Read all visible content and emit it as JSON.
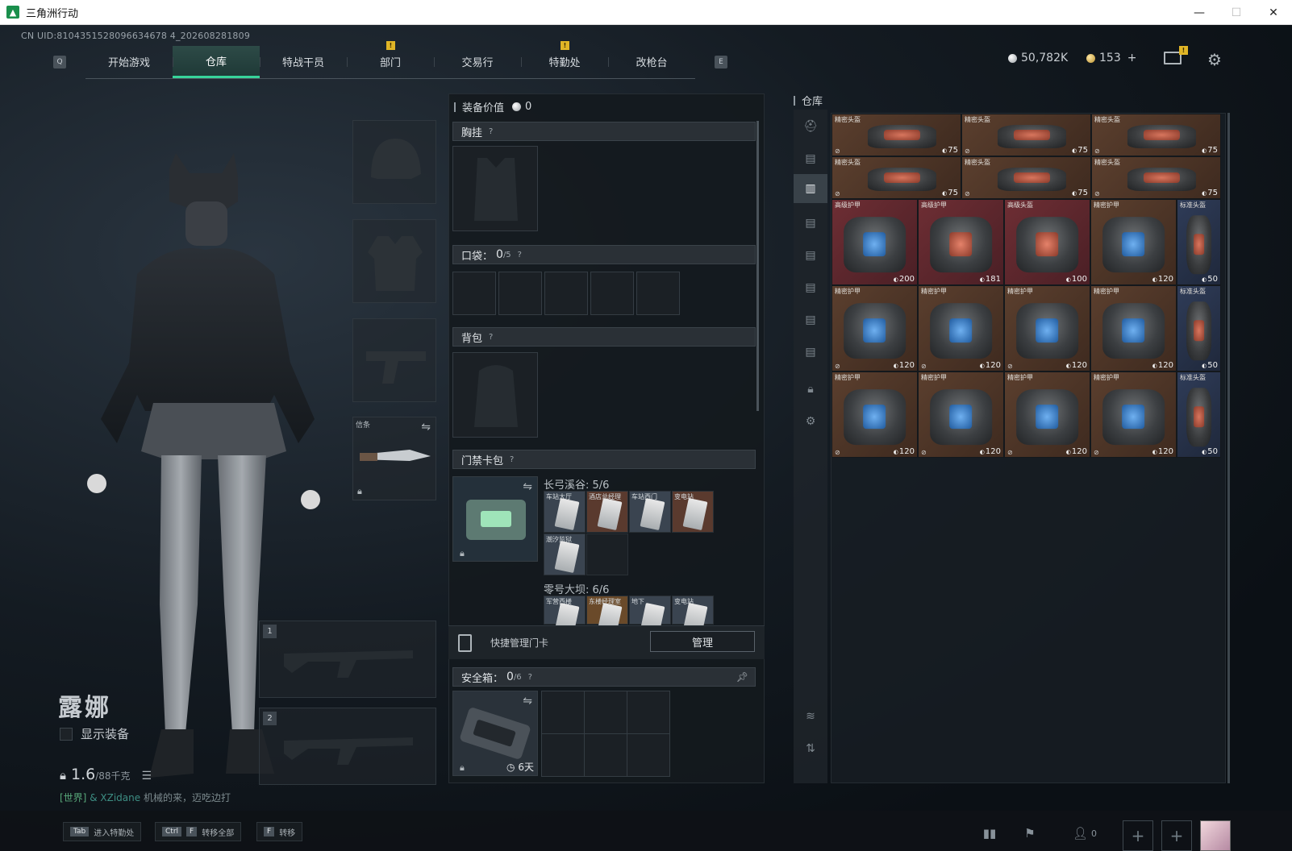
{
  "window": {
    "title": "三角洲行动",
    "minimize": "—",
    "maximize": "☐",
    "close": "✕"
  },
  "uid": "CN UID:8104351528096634678 4_202608281809",
  "nav": {
    "key_left": "Q",
    "key_right": "E",
    "tabs": [
      {
        "label": "开始游戏",
        "badge": ""
      },
      {
        "label": "仓库",
        "badge": ""
      },
      {
        "label": "特战干员",
        "badge": ""
      },
      {
        "label": "部门",
        "badge": "!"
      },
      {
        "label": "交易行",
        "badge": ""
      },
      {
        "label": "特勤处",
        "badge": "!"
      },
      {
        "label": "改枪台",
        "badge": ""
      }
    ],
    "active_tab": "仓库"
  },
  "currency": {
    "silver": "50,782K",
    "gold": "153",
    "gold_add": "+"
  },
  "mail_badge": "!",
  "character": {
    "name": "露娜",
    "show_equipment_label": "显示装备",
    "weight_value": "1.6",
    "weight_unit": "/88千克",
    "chat_channel": "[世界]",
    "chat_user": "& XZidane",
    "chat_text": "机械的来，迈吃边打"
  },
  "equipment": {
    "melee_label": "信条",
    "slot1": "1",
    "slot2": "2"
  },
  "middle": {
    "value_label": "装备价值",
    "value": "0",
    "chest_rig": "胸挂",
    "pockets": "口袋：",
    "pockets_count": "0",
    "pockets_cap": "/5",
    "backpack": "背包",
    "keycard_pack": "门禁卡包",
    "help": "?",
    "region1_label": "长弓溪谷: 5/6",
    "region1_cards": [
      "车站大厅",
      "酒店总经理",
      "车站西门",
      "变电站",
      "潮汐监狱"
    ],
    "region2_label": "零号大坝: 6/6",
    "region2_cards": [
      "军营西楼",
      "东楼经理室",
      "地下",
      "变电站"
    ],
    "quick_label": "快捷管理门卡",
    "manage_button": "管理",
    "safebox_label": "安全箱：",
    "safebox_count": "0",
    "safebox_cap": "/6",
    "safebox_time": "6天"
  },
  "warehouse": {
    "title": "仓库",
    "row1": [
      {
        "name": "精密头盔",
        "dur": "75"
      },
      {
        "name": "精密头盔",
        "dur": "75"
      },
      {
        "name": "精密头盔",
        "dur": "75"
      }
    ],
    "row2": [
      {
        "name": "精密头盔",
        "dur": "75"
      },
      {
        "name": "精密头盔",
        "dur": "75"
      },
      {
        "name": "精密头盔",
        "dur": "75"
      }
    ],
    "row3": [
      {
        "name": "高级护甲",
        "dur": "200"
      },
      {
        "name": "高级护甲",
        "dur": "181"
      },
      {
        "name": "高级头盔",
        "dur": "100"
      },
      {
        "name": "精密护甲",
        "dur": "120"
      },
      {
        "name": "标准头盔",
        "dur": "50"
      }
    ],
    "row4": [
      {
        "name": "精密护甲",
        "dur": "120"
      },
      {
        "name": "精密护甲",
        "dur": "120"
      },
      {
        "name": "精密护甲",
        "dur": "120"
      },
      {
        "name": "精密护甲",
        "dur": "120"
      },
      {
        "name": "标准头盔",
        "dur": "50"
      }
    ],
    "row5": [
      {
        "name": "精密护甲",
        "dur": "120"
      },
      {
        "name": "精密护甲",
        "dur": "120"
      },
      {
        "name": "精密护甲",
        "dur": "120"
      },
      {
        "name": "精密护甲",
        "dur": "120"
      },
      {
        "name": "标准头盔",
        "dur": "50"
      }
    ]
  },
  "bottom": {
    "hint1_key": "Tab",
    "hint1_label": "进入特勤处",
    "hint2_key": "Ctrl",
    "hint2_key2": "F",
    "hint2_label": "转移全部",
    "hint3_key": "F",
    "hint3_label": "转移",
    "friends_count": "0"
  },
  "colors": {
    "accent": "#37d49a",
    "badge": "#e0b526"
  }
}
